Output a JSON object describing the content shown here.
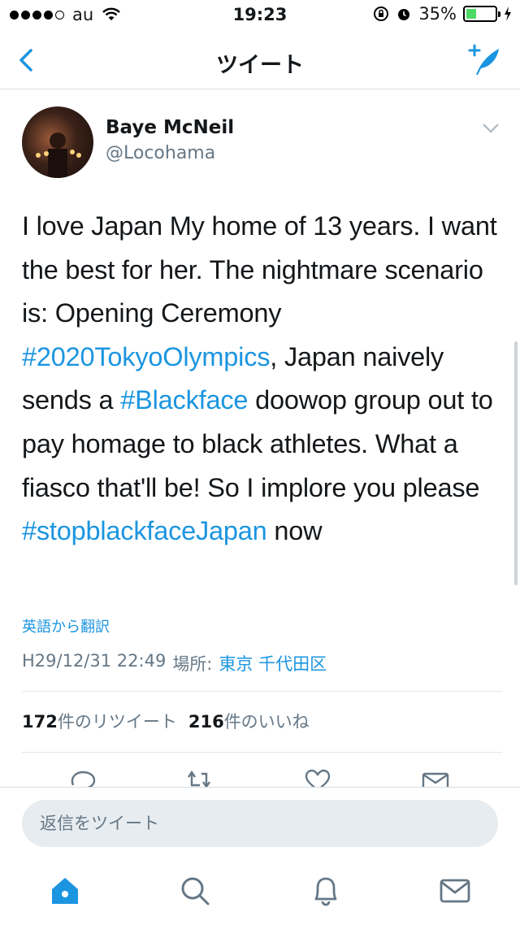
{
  "status_bar": {
    "carrier": "au",
    "time": "19:23",
    "battery_percent": "35%",
    "battery_level": 0.35,
    "battery_color": "#4cd964"
  },
  "nav": {
    "title": "ツイート",
    "back_icon": "chevron-left-icon",
    "compose_icon": "compose-quill-icon",
    "accent_color": "#1b95e0"
  },
  "tweet": {
    "display_name": "Baye McNeil",
    "handle": "@Locohama",
    "text_parts": [
      {
        "text": "I love Japan My home of 13 years. I want the best for her. The nightmare scenario is: Opening Ceremony ",
        "hashtag": false
      },
      {
        "text": "#2020TokyoOlympics",
        "hashtag": true
      },
      {
        "text": ", Japan naively sends a ",
        "hashtag": false
      },
      {
        "text": "#Blackface",
        "hashtag": true
      },
      {
        "text": " doowop group out to pay homage to black athletes. What a fiasco that'll be! So I implore you please ",
        "hashtag": false
      },
      {
        "text": "#stopblackfaceJapan",
        "hashtag": true
      },
      {
        "text": " now",
        "hashtag": false
      }
    ],
    "translate_label": "英語から翻訳",
    "timestamp": "H29/12/31 22:49",
    "location_label": "場所:",
    "location_value": "東京 千代田区",
    "retweet_count": "172",
    "retweet_label": "件のリツイート",
    "like_count": "216",
    "like_label": "件のいいね"
  },
  "actions": [
    "reply-icon",
    "retweet-icon",
    "heart-icon",
    "mail-icon"
  ],
  "reply": {
    "placeholder": "返信をツイート"
  },
  "tabs": [
    "home-icon",
    "search-icon",
    "bell-icon",
    "mail-icon"
  ]
}
